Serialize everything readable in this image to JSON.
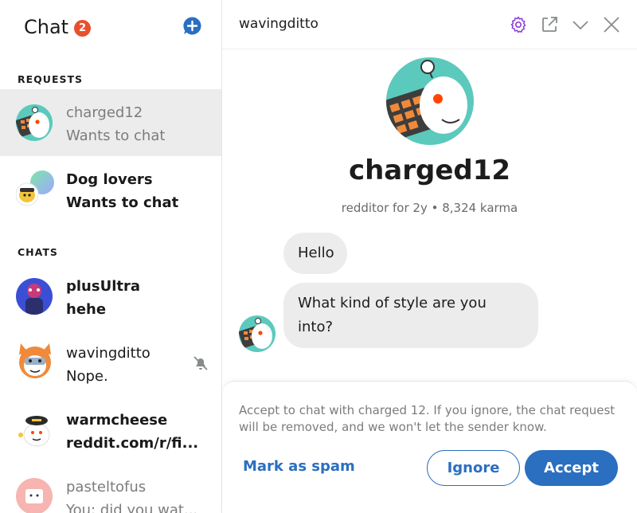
{
  "sidebar": {
    "title": "Chat",
    "unread_count": "2",
    "requests_label": "REQUESTS",
    "chats_label": "CHATS",
    "requests": [
      {
        "name": "charged12",
        "subtitle": "Wants to chat"
      },
      {
        "name": "Dog lovers",
        "subtitle": "Wants to chat"
      }
    ],
    "chats": [
      {
        "name": "plusUltra",
        "subtitle": "hehe"
      },
      {
        "name": "wavingditto",
        "subtitle": "Nope.",
        "muted": true
      },
      {
        "name": "warmcheese",
        "subtitle": "reddit.com/r/fi..."
      },
      {
        "name": "pasteltofus",
        "subtitle": "You: did you wat..."
      }
    ]
  },
  "conversation": {
    "title": "wavingditto",
    "icons": [
      "gear-icon",
      "popout-icon",
      "chevron-down-icon",
      "close-icon"
    ]
  },
  "profile": {
    "name": "charged12",
    "meta": "redditor for 2y • 8,324 karma"
  },
  "messages": [
    {
      "text": "Hello"
    },
    {
      "text": "What kind of style are you into?"
    }
  ],
  "request_panel": {
    "text": "Accept to chat with charged 12. If you ignore, the chat request will be removed, and we won't let the sender know.",
    "spam_label": "Mark as spam",
    "ignore_label": "Ignore",
    "accept_label": "Accept"
  },
  "colors": {
    "accent": "#2a6fc0",
    "badge": "#e8502c",
    "selected_bg": "#ececec",
    "bubble_bg": "#ececec"
  }
}
